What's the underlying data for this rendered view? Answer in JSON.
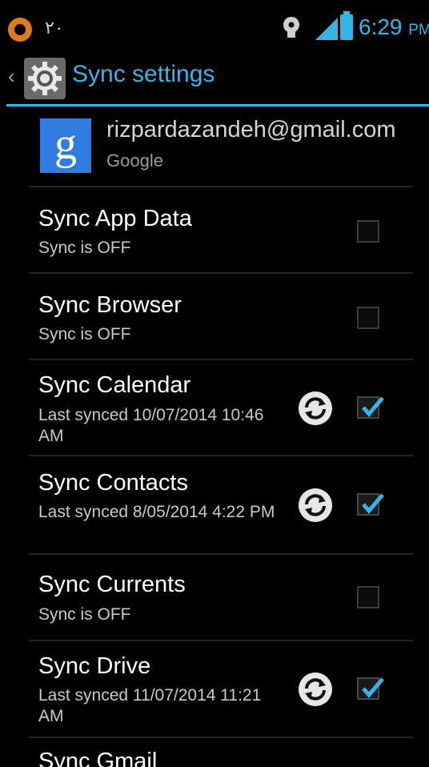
{
  "status_bar": {
    "notification_text": "٢٠",
    "time": "6:29",
    "ampm": "PM"
  },
  "action_bar": {
    "title": "Sync settings",
    "accent_color": "#31b6e7"
  },
  "account": {
    "email": "rizpardazandeh@gmail.com",
    "type": "Google",
    "icon_letter": "g"
  },
  "rows": [
    {
      "title": "Sync App Data",
      "subtitle": "Sync is OFF",
      "checked": false
    },
    {
      "title": "Sync Browser",
      "subtitle": "Sync is OFF",
      "checked": false
    },
    {
      "title": "Sync Calendar",
      "subtitle": "Last synced 10/07/2014 10:46 AM",
      "checked": true
    },
    {
      "title": "Sync Contacts",
      "subtitle": "Last synced 8/05/2014 4:22 PM",
      "checked": true
    },
    {
      "title": "Sync Currents",
      "subtitle": "Sync is OFF",
      "checked": false
    },
    {
      "title": "Sync Drive",
      "subtitle": "Last synced 11/07/2014 11:21 AM",
      "checked": true
    },
    {
      "title": "Sync Gmail"
    }
  ],
  "icons": [
    "notification-icon",
    "bulb-icon",
    "signal-icon",
    "battery-icon",
    "back-chevron-icon",
    "gear-icon",
    "google-icon",
    "sync-icon",
    "checkbox"
  ]
}
